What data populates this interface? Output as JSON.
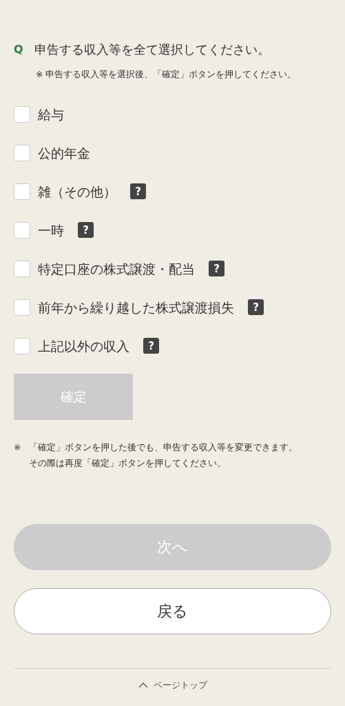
{
  "question": {
    "mark": "Q",
    "text": "申告する収入等を全て選択してください。",
    "note": "※ 申告する収入等を選択後、「確定」ボタンを押してください。"
  },
  "options": [
    {
      "label": "給与",
      "checked": false
    },
    {
      "label": "公的年金",
      "checked": false
    },
    {
      "label": "雑（その他）",
      "checked": false,
      "help": "?"
    },
    {
      "label": "一時",
      "checked": false,
      "help": "?"
    },
    {
      "label": "特定口座の株式譲渡・配当",
      "checked": false,
      "help": "?"
    },
    {
      "label": "前年から繰り越した株式譲渡損失",
      "checked": false,
      "help": "?"
    },
    {
      "label": "上記以外の収入",
      "checked": false,
      "help": "?"
    }
  ],
  "confirm_button": {
    "label": "確定",
    "disabled": true
  },
  "footnote": {
    "mark": "※",
    "lines": [
      "「確定」ボタンを押した後でも、申告する収入等を変更できます。",
      "その際は再度「確定」ボタンを押してください。"
    ]
  },
  "next_button": {
    "label": "次へ",
    "disabled": true
  },
  "back_button": {
    "label": "戻る",
    "disabled": false
  },
  "page_top": {
    "label": "ページトップ"
  }
}
